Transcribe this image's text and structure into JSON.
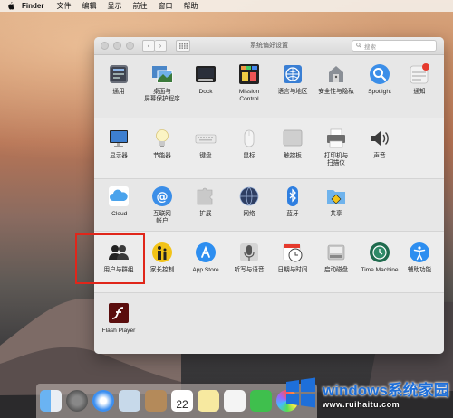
{
  "menubar": {
    "app": "Finder",
    "items": [
      "文件",
      "编辑",
      "显示",
      "前往",
      "窗口",
      "帮助"
    ]
  },
  "window": {
    "title": "系统偏好设置",
    "search_placeholder": "搜索"
  },
  "prefs": {
    "row1": [
      {
        "label": "通用",
        "icon": "general-icon"
      },
      {
        "label": "桌面与\n屏幕保护程序",
        "icon": "desktop-icon"
      },
      {
        "label": "Dock",
        "icon": "dock-icon"
      },
      {
        "label": "Mission\nControl",
        "icon": "mission-control-icon"
      },
      {
        "label": "语言与地区",
        "icon": "language-icon"
      },
      {
        "label": "安全性与隐私",
        "icon": "security-icon"
      },
      {
        "label": "Spotlight",
        "icon": "spotlight-icon"
      },
      {
        "label": "通知",
        "icon": "notifications-icon"
      }
    ],
    "row2": [
      {
        "label": "显示器",
        "icon": "displays-icon"
      },
      {
        "label": "节能器",
        "icon": "energy-icon"
      },
      {
        "label": "键盘",
        "icon": "keyboard-icon"
      },
      {
        "label": "鼠标",
        "icon": "mouse-icon"
      },
      {
        "label": "触控板",
        "icon": "trackpad-icon"
      },
      {
        "label": "打印机与\n扫描仪",
        "icon": "printer-icon"
      },
      {
        "label": "声音",
        "icon": "sound-icon"
      }
    ],
    "row3": [
      {
        "label": "iCloud",
        "icon": "icloud-icon"
      },
      {
        "label": "互联网\n帐户",
        "icon": "internet-accounts-icon"
      },
      {
        "label": "扩展",
        "icon": "extensions-icon"
      },
      {
        "label": "网络",
        "icon": "network-icon"
      },
      {
        "label": "蓝牙",
        "icon": "bluetooth-icon"
      },
      {
        "label": "共享",
        "icon": "sharing-icon"
      }
    ],
    "row4": [
      {
        "label": "用户与群组",
        "icon": "users-groups-icon"
      },
      {
        "label": "家长控制",
        "icon": "parental-controls-icon"
      },
      {
        "label": "App Store",
        "icon": "app-store-icon"
      },
      {
        "label": "听写与语音",
        "icon": "dictation-icon"
      },
      {
        "label": "日期与时间",
        "icon": "date-time-icon"
      },
      {
        "label": "启动磁盘",
        "icon": "startup-disk-icon"
      },
      {
        "label": "Time Machine",
        "icon": "time-machine-icon"
      },
      {
        "label": "辅助功能",
        "icon": "accessibility-icon"
      }
    ],
    "row5": [
      {
        "label": "Flash Player",
        "icon": "flash-player-icon"
      }
    ]
  },
  "dock": {
    "calendar_day": "22"
  },
  "watermark": {
    "brand": "windows系统家园",
    "url": "www.ruihaitu.com"
  }
}
